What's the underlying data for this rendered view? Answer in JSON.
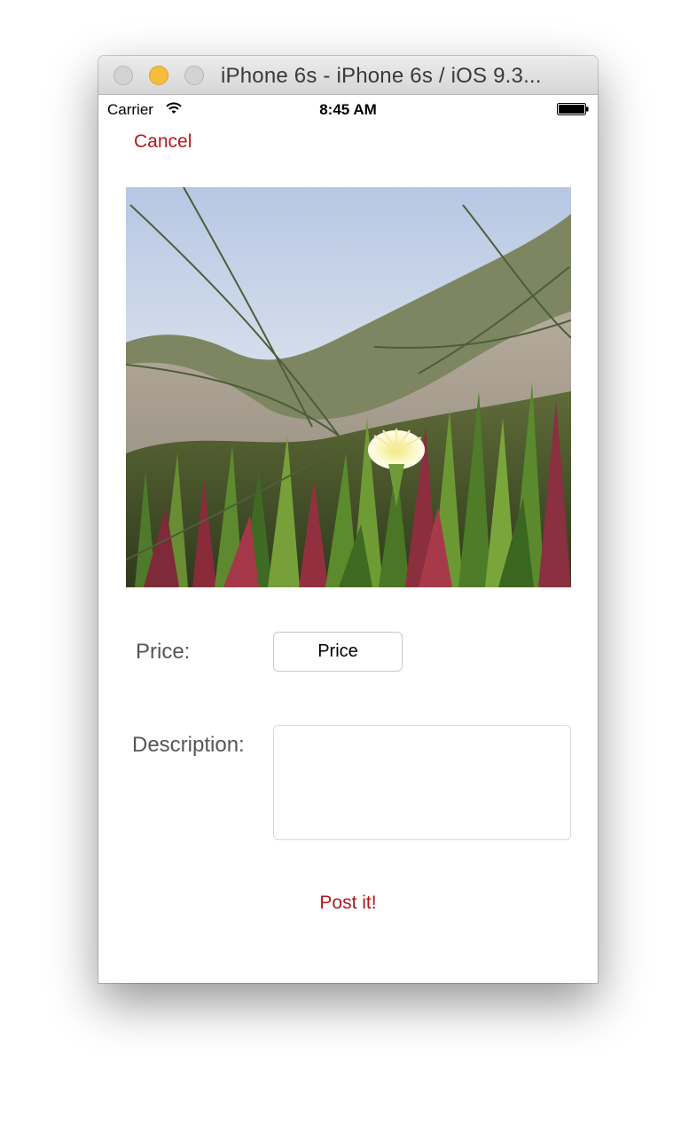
{
  "window": {
    "title": "iPhone 6s - iPhone 6s / iOS 9.3..."
  },
  "status_bar": {
    "carrier": "Carrier",
    "time": "8:45 AM",
    "icons": [
      "wifi-icon",
      "battery-icon"
    ]
  },
  "nav": {
    "cancel_label": "Cancel"
  },
  "photo": {
    "alt": "Close-up of ice plant succulents with a pale yellow flower on a sandy dune with tall grass blades against a pale blue sky"
  },
  "form": {
    "price_label": "Price:",
    "price_placeholder": "Price",
    "price_value": "",
    "description_label": "Description:",
    "description_value": "",
    "submit_label": "Post it!"
  },
  "colors": {
    "accent": "#b3181c",
    "label": "#555555",
    "traffic_minimize": "#f6bd3b"
  }
}
